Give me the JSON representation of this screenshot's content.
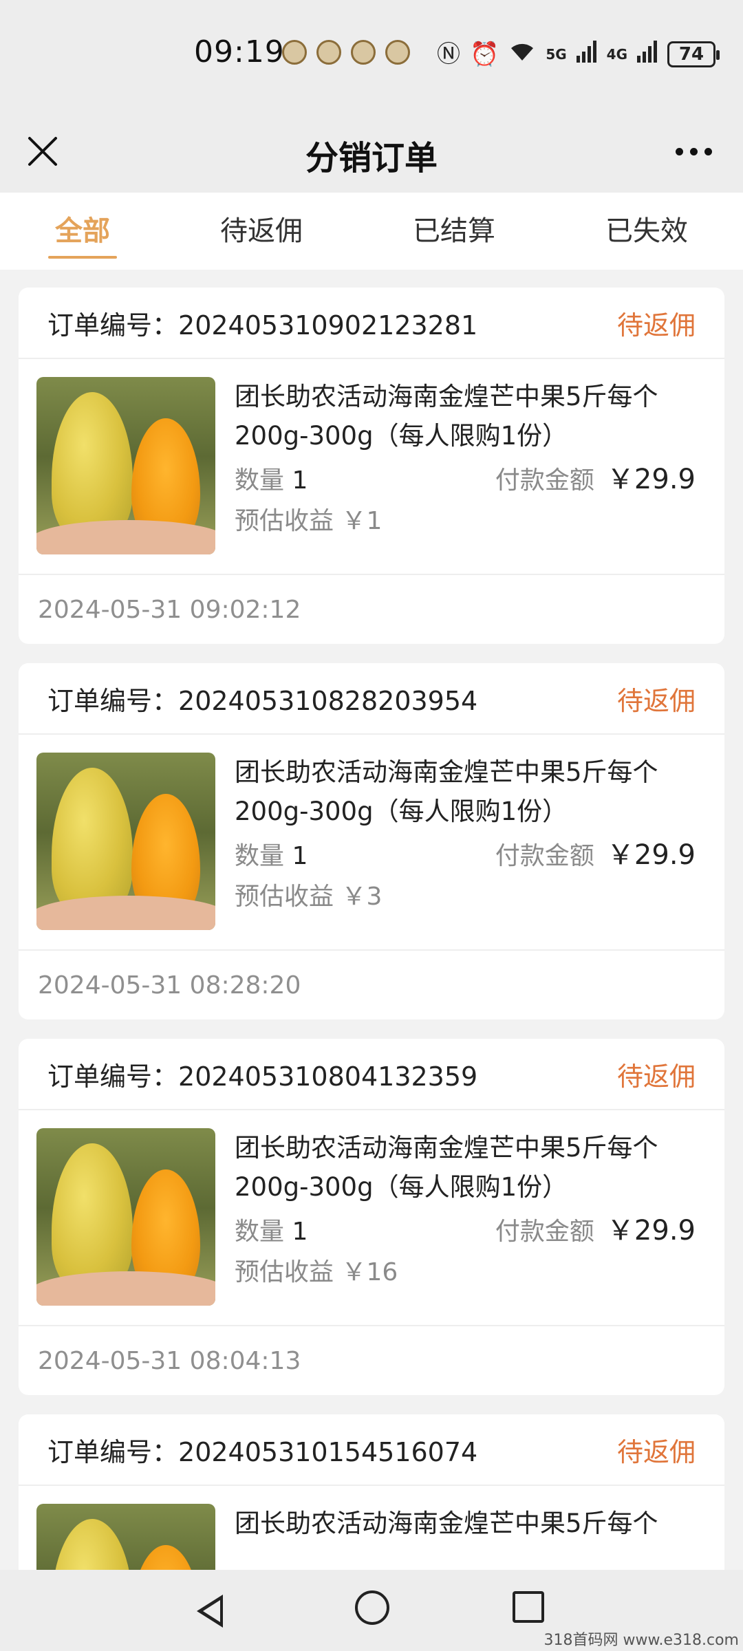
{
  "status_bar": {
    "time": "09:19",
    "signal_5g": "5G",
    "signal_4g": "4G",
    "battery": "74"
  },
  "header": {
    "title": "分销订单"
  },
  "tabs": [
    {
      "label": "全部",
      "active": true
    },
    {
      "label": "待返佣",
      "active": false
    },
    {
      "label": "已结算",
      "active": false
    },
    {
      "label": "已失效",
      "active": false
    }
  ],
  "labels": {
    "order_no_prefix": "订单编号：",
    "qty_prefix": "数量",
    "pay_label": "付款金额",
    "est_prefix": "预估收益"
  },
  "orders": [
    {
      "order_no": "20240531090212328 1",
      "status": "待返佣",
      "product": "团长助农活动海南金煌芒中果5斤每个200g-300g（每人限购1份）",
      "qty": "1",
      "amount": "￥29.9",
      "est_income": "￥1",
      "time": "2024-05-31 09:02:12"
    },
    {
      "order_no": "202405310828203954",
      "status": "待返佣",
      "product": "团长助农活动海南金煌芒中果5斤每个200g-300g（每人限购1份）",
      "qty": "1",
      "amount": "￥29.9",
      "est_income": "￥3",
      "time": "2024-05-31 08:28:20"
    },
    {
      "order_no": "202405310804132359",
      "status": "待返佣",
      "product": "团长助农活动海南金煌芒中果5斤每个200g-300g（每人限购1份）",
      "qty": "1",
      "amount": "￥29.9",
      "est_income": "￥16",
      "time": "2024-05-31 08:04:13"
    },
    {
      "order_no": "202405310154516074",
      "status": "待返佣",
      "product": "团长助农活动海南金煌芒中果5斤每个",
      "qty": "",
      "amount": "",
      "est_income": "",
      "time": ""
    }
  ],
  "watermark": "318首码网 www.e318.com",
  "colors": {
    "accent": "#e4a35a",
    "status": "#e0753a"
  }
}
